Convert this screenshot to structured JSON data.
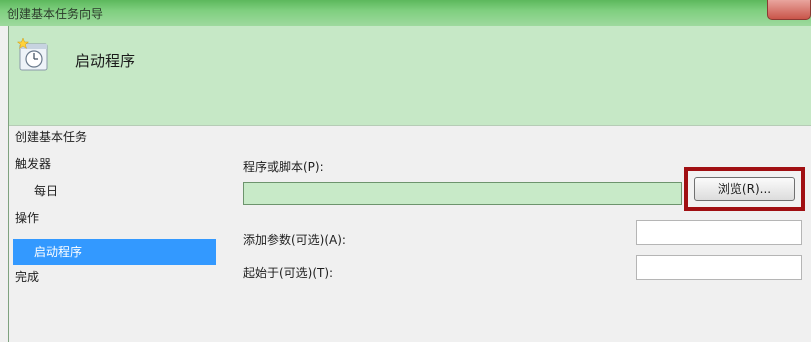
{
  "window": {
    "title": "创建基本任务向导"
  },
  "header": {
    "title": "启动程序",
    "icon": "task-clock-icon"
  },
  "sidebar": {
    "items": [
      {
        "label": "创建基本任务"
      },
      {
        "label": "触发器"
      },
      {
        "label": "每日"
      },
      {
        "label": "操作"
      },
      {
        "label": "启动程序"
      },
      {
        "label": "完成"
      }
    ],
    "selected": "启动程序"
  },
  "form": {
    "program_label": "程序或脚本(P):",
    "program_value": "",
    "browse_label": "浏览(R)...",
    "args_label": "添加参数(可选)(A):",
    "args_value": "",
    "startin_label": "起始于(可选)(T):",
    "startin_value": ""
  },
  "colors": {
    "header_bg": "#c6e8c6",
    "selected_bg": "#3399ff",
    "highlight_border": "#a00f12"
  }
}
